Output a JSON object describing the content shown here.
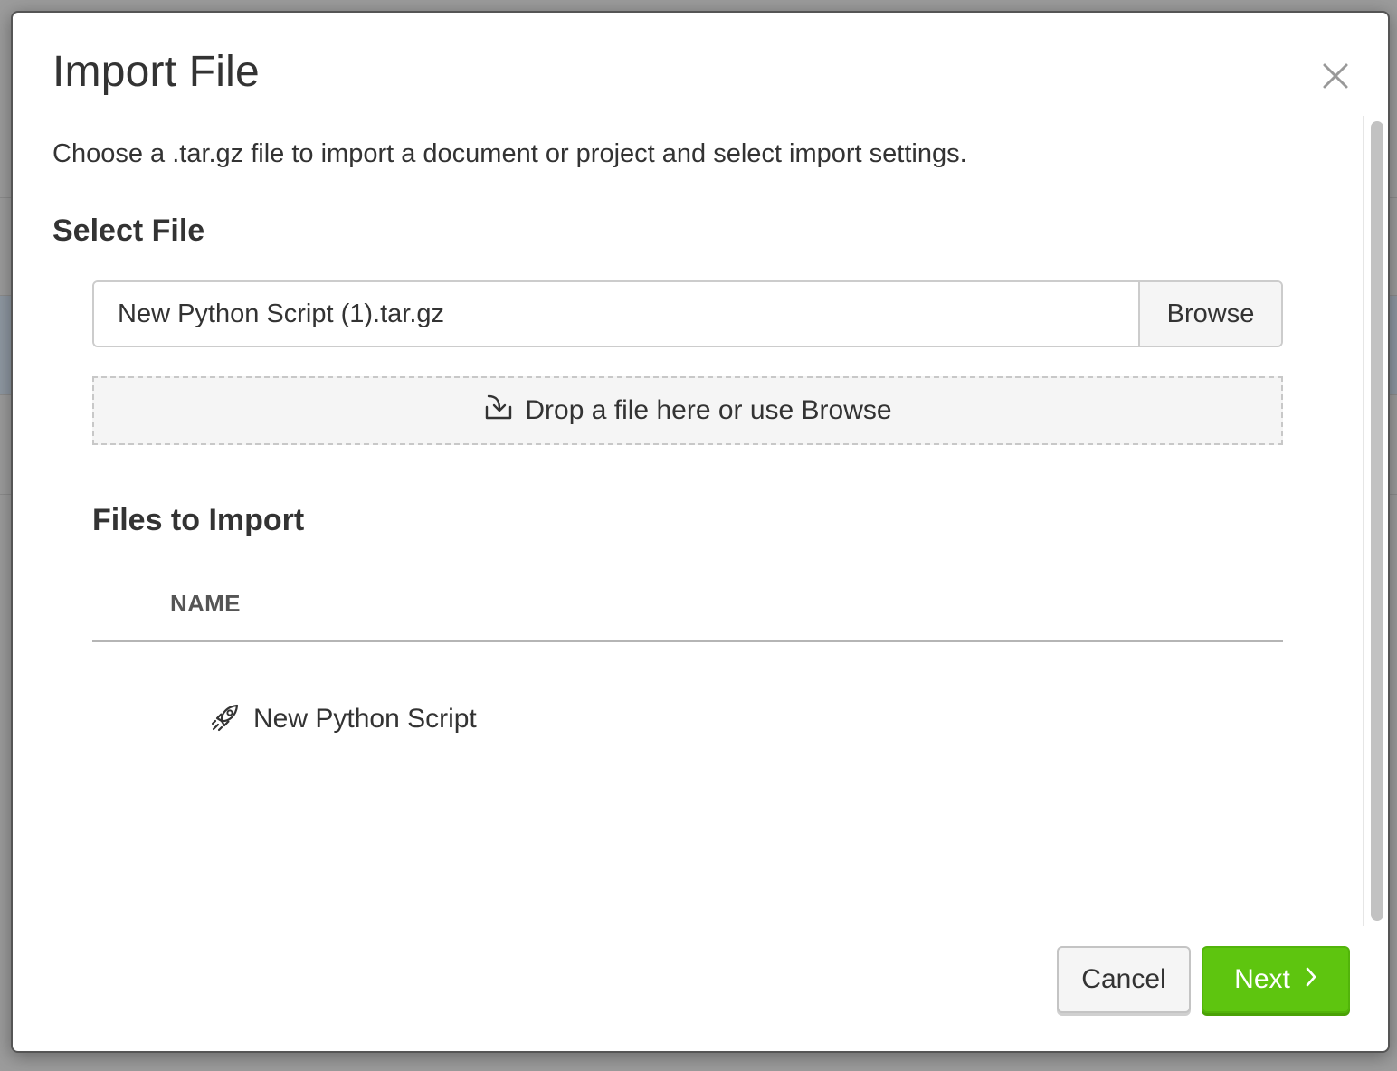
{
  "dialog": {
    "title": "Import File",
    "description": "Choose a .tar.gz file to import a document or project and select import settings."
  },
  "select_file": {
    "heading": "Select File",
    "file_value": "New Python Script (1).tar.gz",
    "browse_label": "Browse",
    "drop_zone_text": "Drop a file here or use Browse"
  },
  "files_to_import": {
    "heading": "Files to Import",
    "columns": [
      "NAME"
    ],
    "rows": [
      {
        "name": "New Python Script",
        "icon": "rocket-icon"
      }
    ]
  },
  "footer": {
    "cancel_label": "Cancel",
    "next_label": "Next"
  },
  "colors": {
    "primary_button": "#5ec50f",
    "text": "#333333",
    "border": "#cccccc"
  }
}
